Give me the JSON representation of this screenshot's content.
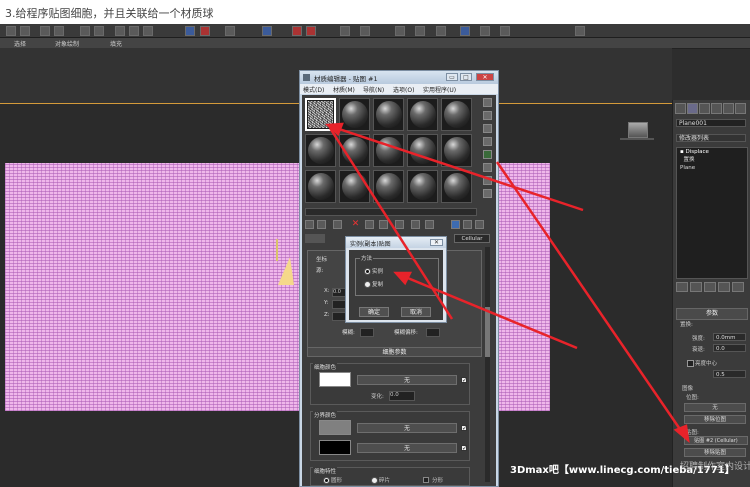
{
  "caption": "3.给程序贴图细胞，并且关联给一个材质球",
  "toolbar": {
    "sub_tabs": [
      "选择",
      "对象绘制",
      "填充"
    ]
  },
  "material_editor": {
    "title": "材质编辑器 - 贴图 #1",
    "menu": [
      "模式(D)",
      "材质(M)",
      "导航(N)",
      "选项(O)",
      "实用程序(U)"
    ],
    "window_buttons": [
      "▭",
      "□",
      "✕"
    ],
    "map_type": "Cellular",
    "coords_rollout": {
      "header": "坐标",
      "source_label": "源:",
      "axis_labels": [
        "X:",
        "Y:",
        "Z:"
      ],
      "blur_label": "模糊:",
      "blur_offset_label": "模糊偏移:",
      "x_value": "0.0"
    },
    "cellular_rollout": {
      "header": "细胞参数",
      "cell_color": {
        "label": "细胞颜色",
        "swatch": "#ffffff",
        "map_label": "无",
        "variation_label": "变化:",
        "variation_value": "0.0"
      },
      "division_colors": {
        "label": "分界颜色",
        "swatches": [
          "#808080",
          "#000000"
        ],
        "map_labels": [
          "无",
          "无"
        ]
      },
      "characteristics": {
        "label": "细胞特性",
        "options": [
          "圆形",
          "碎片",
          "分形"
        ]
      }
    }
  },
  "dialog": {
    "title": "实例(副本)贴图",
    "close_label": "✕",
    "group_label": "方法",
    "options": [
      "实例",
      "复制"
    ],
    "selected": "实例",
    "ok_label": "确定",
    "cancel_label": "取消"
  },
  "command_panel": {
    "object_name": "Plane001",
    "modifier_list_label": "修改器列表",
    "stack": [
      "Displace",
      "置换",
      "Plane"
    ],
    "params_rollout": "参数",
    "strength_label": "强度:",
    "decay_label": "衰退:",
    "strength_value": "0.0mm",
    "decay_value": "0.0",
    "center_luminance_label": "亮度中心",
    "center_value": "0.5",
    "image_label": "图像",
    "bitmap_label": "位图:",
    "bitmap_none": "无",
    "remove_bitmap": "移除位图",
    "map_label": "贴图:",
    "map_value": "贴图 #2 (Cellular)",
    "remove_map": "移除贴图"
  },
  "watermark": "3Dmax吧【www.linecg.com/tieba/1771】",
  "watermark_faint": "招聘制作室内设计"
}
